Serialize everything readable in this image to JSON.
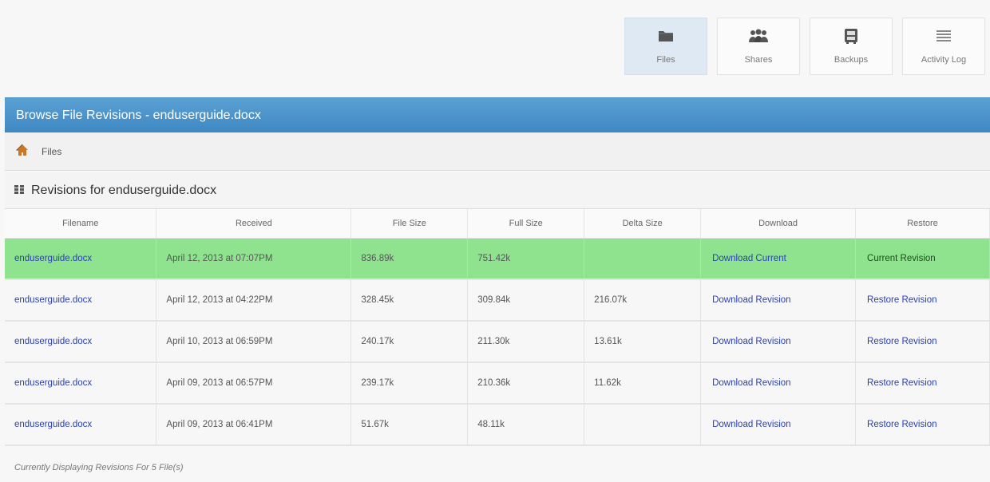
{
  "nav": {
    "items": [
      {
        "label": "Files",
        "icon": "folder-icon",
        "active": true
      },
      {
        "label": "Shares",
        "icon": "users-icon",
        "active": false
      },
      {
        "label": "Backups",
        "icon": "safe-icon",
        "active": false
      },
      {
        "label": "Activity Log",
        "icon": "list-icon",
        "active": false
      }
    ]
  },
  "header": {
    "title": "Browse File Revisions - enduserguide.docx"
  },
  "breadcrumb": {
    "home_icon": "home-icon",
    "label": "Files"
  },
  "panel": {
    "title": "Revisions for enduserguide.docx",
    "icon": "grid-icon"
  },
  "table": {
    "columns": [
      "Filename",
      "Received",
      "File Size",
      "Full Size",
      "Delta Size",
      "Download",
      "Restore"
    ],
    "rows": [
      {
        "filename": "enduserguide.docx",
        "received": "April 12, 2013 at 07:07PM",
        "file_size": "836.89k",
        "full_size": "751.42k",
        "delta_size": "",
        "download": "Download Current",
        "restore": "Current Revision",
        "current": true
      },
      {
        "filename": "enduserguide.docx",
        "received": "April 12, 2013 at 04:22PM",
        "file_size": "328.45k",
        "full_size": "309.84k",
        "delta_size": "216.07k",
        "download": "Download Revision",
        "restore": "Restore Revision",
        "current": false
      },
      {
        "filename": "enduserguide.docx",
        "received": "April 10, 2013 at 06:59PM",
        "file_size": "240.17k",
        "full_size": "211.30k",
        "delta_size": "13.61k",
        "download": "Download Revision",
        "restore": "Restore Revision",
        "current": false
      },
      {
        "filename": "enduserguide.docx",
        "received": "April 09, 2013 at 06:57PM",
        "file_size": "239.17k",
        "full_size": "210.36k",
        "delta_size": "11.62k",
        "download": "Download Revision",
        "restore": "Restore Revision",
        "current": false
      },
      {
        "filename": "enduserguide.docx",
        "received": "April 09, 2013 at 06:41PM",
        "file_size": "51.67k",
        "full_size": "48.11k",
        "delta_size": "",
        "download": "Download Revision",
        "restore": "Restore Revision",
        "current": false
      }
    ]
  },
  "footer": {
    "text": "Currently Displaying Revisions For 5 File(s)"
  },
  "colors": {
    "header_blue": "#4a92c9",
    "current_row_green": "#8fe38f",
    "link_blue": "#2a3fb8",
    "active_nav": "#dfe9f3"
  }
}
